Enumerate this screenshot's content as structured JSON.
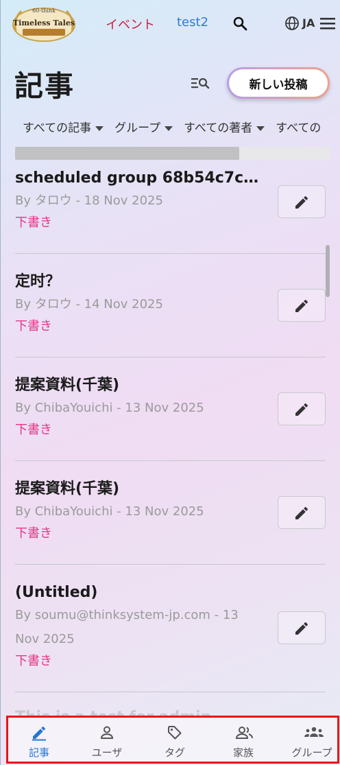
{
  "header": {
    "logo_text": "Timeless Tales",
    "logo_small": "60-think",
    "nav_event": "イベント",
    "nav_user": "test2",
    "lang": "JA"
  },
  "page": {
    "title": "記事",
    "new_post_label": "新しい投稿"
  },
  "filters": [
    "すべての記事",
    "グループ",
    "すべての著者",
    "すべての"
  ],
  "progress": {
    "fraction": 0.71
  },
  "posts": [
    {
      "title": "scheduled group 68b54c7c2…",
      "meta": "By タロウ - 18 Nov 2025",
      "status": "下書き"
    },
    {
      "title": "定时？",
      "meta": "By タロウ - 14 Nov 2025",
      "status": "下書き"
    },
    {
      "title": "提案資料(千葉)",
      "meta": "By ChibaYouichi - 13 Nov 2025",
      "status": "下書き"
    },
    {
      "title": "提案資料(千葉)",
      "meta": "By ChibaYouichi - 13 Nov 2025",
      "status": "下書き"
    },
    {
      "title": "(Untitled)",
      "meta": "By soumu@thinksystem-jp.com - 13 Nov 2025",
      "status": "下書き"
    },
    {
      "title": "This is a test for admin",
      "meta": "",
      "status": ""
    }
  ],
  "bottom_nav": [
    {
      "label": "記事",
      "icon": "edit-icon",
      "active": true
    },
    {
      "label": "ユーザ",
      "icon": "person-icon",
      "active": false
    },
    {
      "label": "タグ",
      "icon": "tag-icon",
      "active": false
    },
    {
      "label": "家族",
      "icon": "people-icon",
      "active": false
    },
    {
      "label": "グループ",
      "icon": "groups-icon",
      "active": false
    }
  ],
  "colors": {
    "event_red": "#cf1d38",
    "link_blue": "#2d7bd8",
    "status_pink": "#e53587",
    "active_tab": "#2578d2",
    "highlight_border": "#e8141a"
  }
}
